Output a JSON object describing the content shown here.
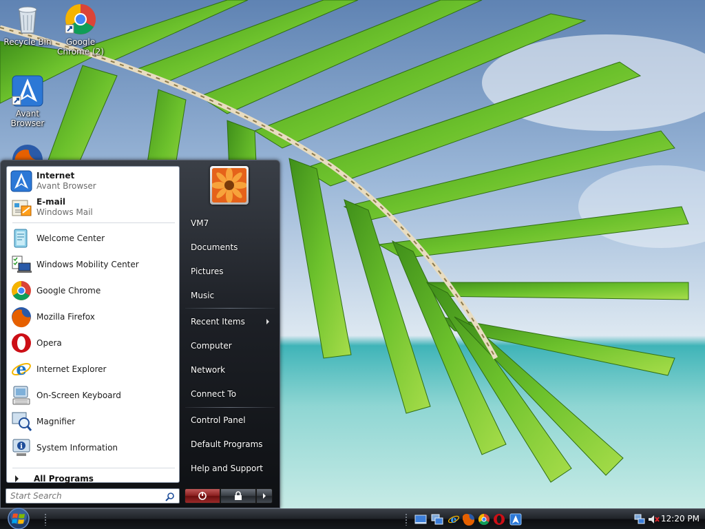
{
  "desktop": {
    "icons": [
      {
        "label": "Recycle Bin",
        "icon": "recycle-bin-icon"
      },
      {
        "label": "Google\nChrome (2)",
        "icon": "chrome-icon"
      },
      {
        "label": "Avant\nBrowser",
        "icon": "avant-browser-icon"
      },
      {
        "label": "",
        "icon": "firefox-icon"
      }
    ]
  },
  "start_menu": {
    "pinned": [
      {
        "title": "Internet",
        "subtitle": "Avant Browser",
        "icon": "avant-browser-icon"
      },
      {
        "title": "E-mail",
        "subtitle": "Windows Mail",
        "icon": "windows-mail-icon"
      }
    ],
    "recent": [
      {
        "label": "Welcome Center",
        "icon": "welcome-center-icon"
      },
      {
        "label": "Windows Mobility Center",
        "icon": "mobility-center-icon"
      },
      {
        "label": "Google Chrome",
        "icon": "chrome-icon"
      },
      {
        "label": "Mozilla Firefox",
        "icon": "firefox-icon"
      },
      {
        "label": "Opera",
        "icon": "opera-icon"
      },
      {
        "label": "Internet Explorer",
        "icon": "internet-explorer-icon"
      },
      {
        "label": "On-Screen Keyboard",
        "icon": "keyboard-icon"
      },
      {
        "label": "Magnifier",
        "icon": "magnifier-icon"
      },
      {
        "label": "System Information",
        "icon": "system-information-icon"
      }
    ],
    "all_programs": "All Programs",
    "search_placeholder": "Start Search",
    "right": {
      "user": "VM7",
      "documents": "Documents",
      "pictures": "Pictures",
      "music": "Music",
      "recent_items": "Recent Items",
      "computer": "Computer",
      "network": "Network",
      "connect_to": "Connect To",
      "control_panel": "Control Panel",
      "default_programs": "Default Programs",
      "help_support": "Help and Support"
    }
  },
  "taskbar": {
    "quick_launch": [
      "show-desktop-icon",
      "switch-windows-icon",
      "internet-explorer-icon",
      "firefox-icon",
      "chrome-icon",
      "opera-icon",
      "avant-browser-icon"
    ],
    "tray_icons": [
      "network-icon",
      "volume-muted-icon"
    ],
    "clock": "12:20 PM"
  },
  "colors": {
    "accent": "#1e4e9a",
    "menu_dark": "#1d2026",
    "power_red": "#8c1f1f"
  }
}
